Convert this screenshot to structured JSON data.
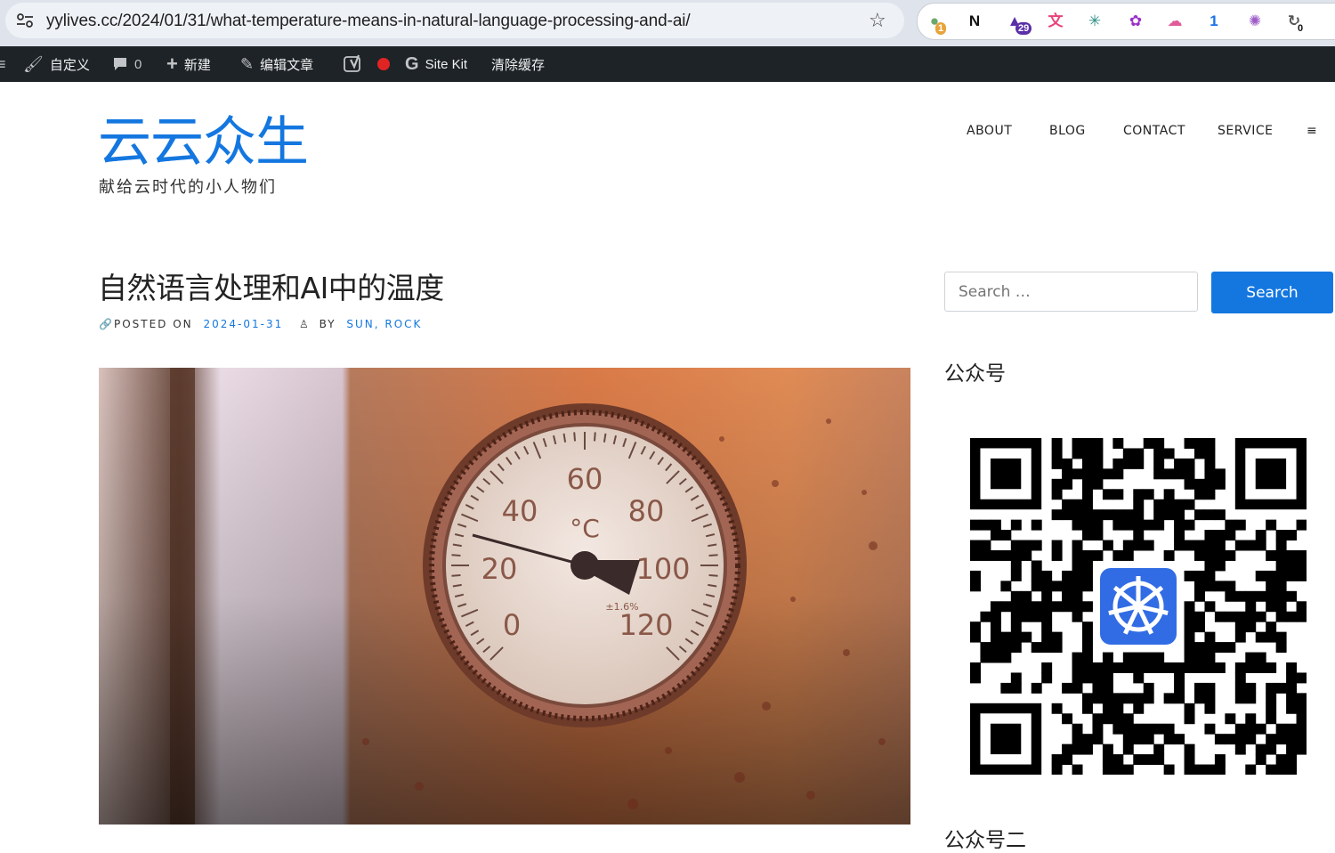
{
  "browser": {
    "url": "yylives.cc/2024/01/31/what-temperature-means-in-natural-language-processing-and-ai/",
    "extensions": [
      {
        "name": "grammar-extension-icon",
        "badge": "1",
        "color": "#6aa86b"
      },
      {
        "name": "notion-extension-icon",
        "badge": "",
        "color": "#111111"
      },
      {
        "name": "scholar-extension-icon",
        "badge": "29",
        "color": "#5b2fa8"
      },
      {
        "name": "translate-extension-icon",
        "badge": "",
        "color": "#e8447a"
      },
      {
        "name": "pattern-extension-icon",
        "badge": "",
        "color": "#2a8f84"
      },
      {
        "name": "purple-extension-icon",
        "badge": "",
        "color": "#9b2fc9"
      },
      {
        "name": "cloud-extension-icon",
        "badge": "",
        "color": "#e05a98"
      },
      {
        "name": "blue-extension-icon",
        "badge": "",
        "color": "#1a73e8"
      },
      {
        "name": "openai-extension-icon",
        "badge": "",
        "color": "#9d5cc8"
      },
      {
        "name": "refresh-extension-icon",
        "badge": "0",
        "color": "#555555"
      }
    ]
  },
  "admin_bar": {
    "customize": "自定义",
    "comments": "0",
    "new": "新建",
    "edit": "编辑文章",
    "site_kit": "Site Kit",
    "clear_cache": "清除缓存"
  },
  "site": {
    "title": "云云众生",
    "tagline": "献给云时代的小人物们"
  },
  "nav": [
    "ABOUT",
    "BLOG",
    "CONTACT",
    "SERVICE",
    "≡"
  ],
  "post": {
    "title": "自然语言处理和AI中的温度",
    "posted_on_label": "POSTED ON",
    "date": "2024-01-31",
    "by_label": "BY",
    "authors": "SUN, ROCK"
  },
  "gauge": {
    "labels": [
      "0",
      "20",
      "40",
      "60",
      "80",
      "100",
      "120"
    ],
    "unit": "°C",
    "tolerance": "±1.6%"
  },
  "sidebar": {
    "search_placeholder": "Search …",
    "search_button": "Search",
    "widget_title": "公众号",
    "next_widget_title": "公众号二"
  },
  "colors": {
    "accent": "#1477e0",
    "admin_bar": "#1d2327",
    "record_dot": "#e02424"
  }
}
